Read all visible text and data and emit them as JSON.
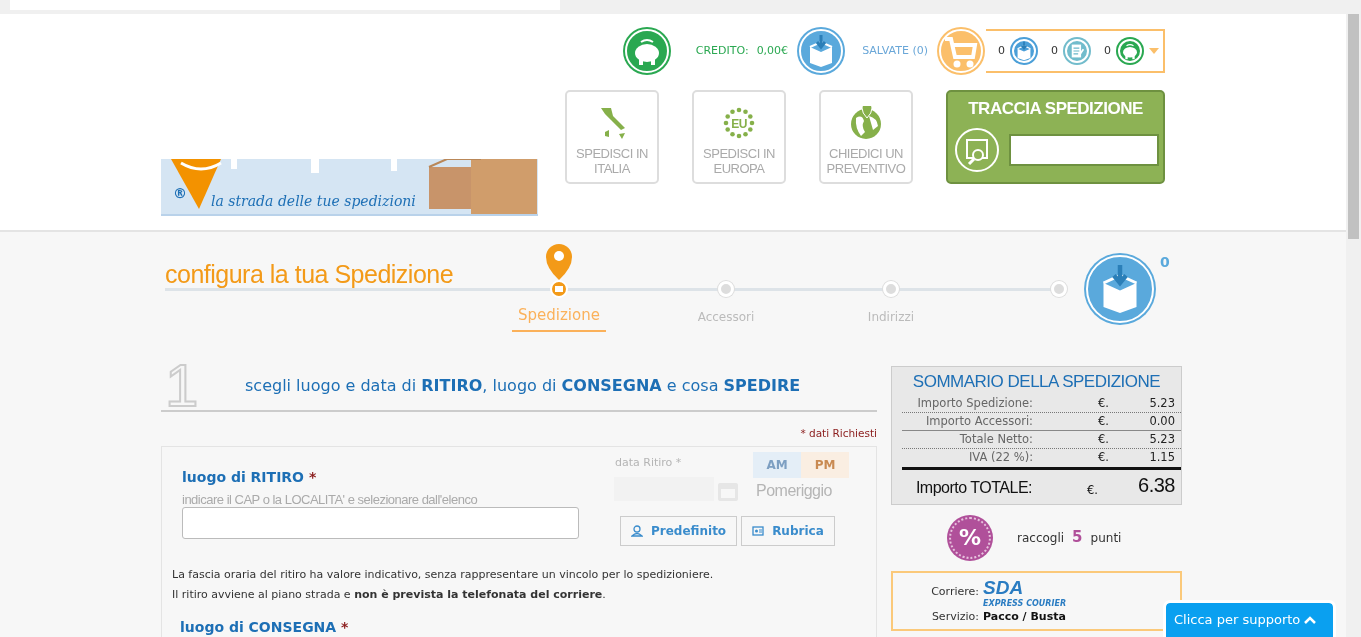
{
  "header": {
    "logo": {
      "mark": "®",
      "tagline": "la strada delle tue spedizioni"
    },
    "credit": {
      "label": "CREDITO:",
      "value": "0,00€"
    },
    "saved": "SALVATE (0)",
    "cart_counts": [
      "0",
      "0",
      "0"
    ],
    "nav_buttons": [
      {
        "label": "SPEDISCI IN ITALIA",
        "kind": "italy"
      },
      {
        "label": "SPEDISCI IN EUROPA",
        "kind": "europe"
      },
      {
        "label": "CHIEDICI UN PREVENTIVO",
        "kind": "world"
      }
    ],
    "eu_label": "EU",
    "tracking": {
      "title": "TRACCIA SPEDIZIONE"
    }
  },
  "progress": {
    "title": "configura la tua Spedizione",
    "box_count": "0",
    "steps": [
      {
        "label": "Spedizione",
        "selected": true
      },
      {
        "label": "Accessori",
        "selected": false
      },
      {
        "label": "Indirizzi",
        "selected": false
      },
      {
        "selected": false
      }
    ]
  },
  "section": {
    "number": "1",
    "heading": "scegli luogo e data di **RITIRO**, luogo di **CONSEGNA** e cosa **SPEDIRE**",
    "required_note": "* dati Richiesti"
  },
  "pickup": {
    "label": "luogo di RITIRO",
    "star": "*",
    "hint": "indicare il CAP o la LOCALITA' e selezionare dall'elenco",
    "date_label": "data Ritiro *",
    "periods": [
      {
        "label": "AM",
        "disabled": true
      },
      {
        "label": "PM",
        "disabled": true
      }
    ],
    "period_text": "Pomeriggio",
    "buttons": [
      {
        "label": "Predefinito",
        "kind": "user"
      },
      {
        "label": "Rubrica",
        "kind": "book"
      }
    ]
  },
  "notes": [
    "La fascia oraria del ritiro ha valore indicativo, senza rappresentare un vincolo per lo spedizioniere.",
    "Il ritiro avviene al piano strada e **non è prevista la telefonata del corriere**."
  ],
  "delivery": {
    "label": "luogo di CONSEGNA",
    "star": "*"
  },
  "summary": {
    "title": "SOMMARIO DELLA SPEDIZIONE",
    "rows": [
      {
        "label": "Importo Spedizione:",
        "currency": "€.",
        "amount": "5.23"
      },
      {
        "label": "Importo Accessori:",
        "currency": "€.",
        "amount": "0.00"
      },
      {
        "label": "Totale Netto:",
        "currency": "€.",
        "amount": "5.23"
      },
      {
        "label": "IVA (22 %):",
        "currency": "€.",
        "amount": "1.15"
      }
    ],
    "total": {
      "label": "Importo TOTALE:",
      "currency": "€.",
      "amount": "6.38"
    }
  },
  "points": {
    "badge": "%",
    "before": "raccogli",
    "value": "5",
    "after": "punti"
  },
  "carrier": {
    "label": "Corriere:",
    "logo": "SDA",
    "logo_sub": "EXPRESS COURIER",
    "service_label": "Servizio:",
    "service": "Pacco / Busta"
  },
  "support": {
    "label": "Clicca per supporto"
  }
}
